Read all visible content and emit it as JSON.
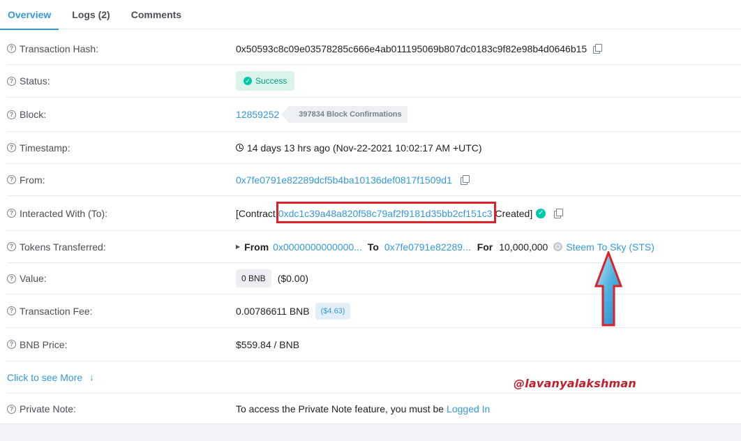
{
  "tabs": [
    {
      "label": "Overview",
      "active": true
    },
    {
      "label": "Logs (2)"
    },
    {
      "label": "Comments"
    }
  ],
  "rows": {
    "tx_hash": {
      "label": "Transaction Hash:",
      "value": "0x50593c8c09e03578285c666e4ab011195069b807dc0183c9f82e98b4d0646b15"
    },
    "status": {
      "label": "Status:",
      "value": "Success"
    },
    "block": {
      "label": "Block:",
      "value": "12859252",
      "confirmations": "397834 Block Confirmations"
    },
    "timestamp": {
      "label": "Timestamp:",
      "value": "14 days 13 hrs ago (Nov-22-2021 10:02:17 AM +UTC)"
    },
    "from": {
      "label": "From:",
      "value": "0x7fe0791e82289dcf5b4ba10136def0817f1509d1"
    },
    "interacted": {
      "label": "Interacted With (To):",
      "prefix": "[Contract",
      "address": "0xdc1c39a48a820f58c79af2f9181d35bb2cf151c3",
      "suffix": "Created]"
    },
    "tokens": {
      "label": "Tokens Transferred:",
      "from_label": "From",
      "from_value": "0x0000000000000...",
      "to_label": "To",
      "to_value": "0x7fe0791e82289...",
      "for_label": "For",
      "amount": "10,000,000",
      "token_name": "Steem To Sky (STS)"
    },
    "value": {
      "label": "Value:",
      "badge": "0 BNB",
      "usd": "($0.00)"
    },
    "fee": {
      "label": "Transaction Fee:",
      "value": "0.00786611 BNB",
      "usd": "($4.63)"
    },
    "bnb_price": {
      "label": "BNB Price:",
      "value": "$559.84 / BNB"
    },
    "see_more": "Click to see More",
    "private_note": {
      "label": "Private Note:",
      "text": "To access the Private Note feature, you must be",
      "link": "Logged In"
    }
  },
  "watermark": "@lavanyalakshman",
  "colors": {
    "link": "#3498db",
    "success": "#00c9a7",
    "highlight": "#d9222a"
  }
}
